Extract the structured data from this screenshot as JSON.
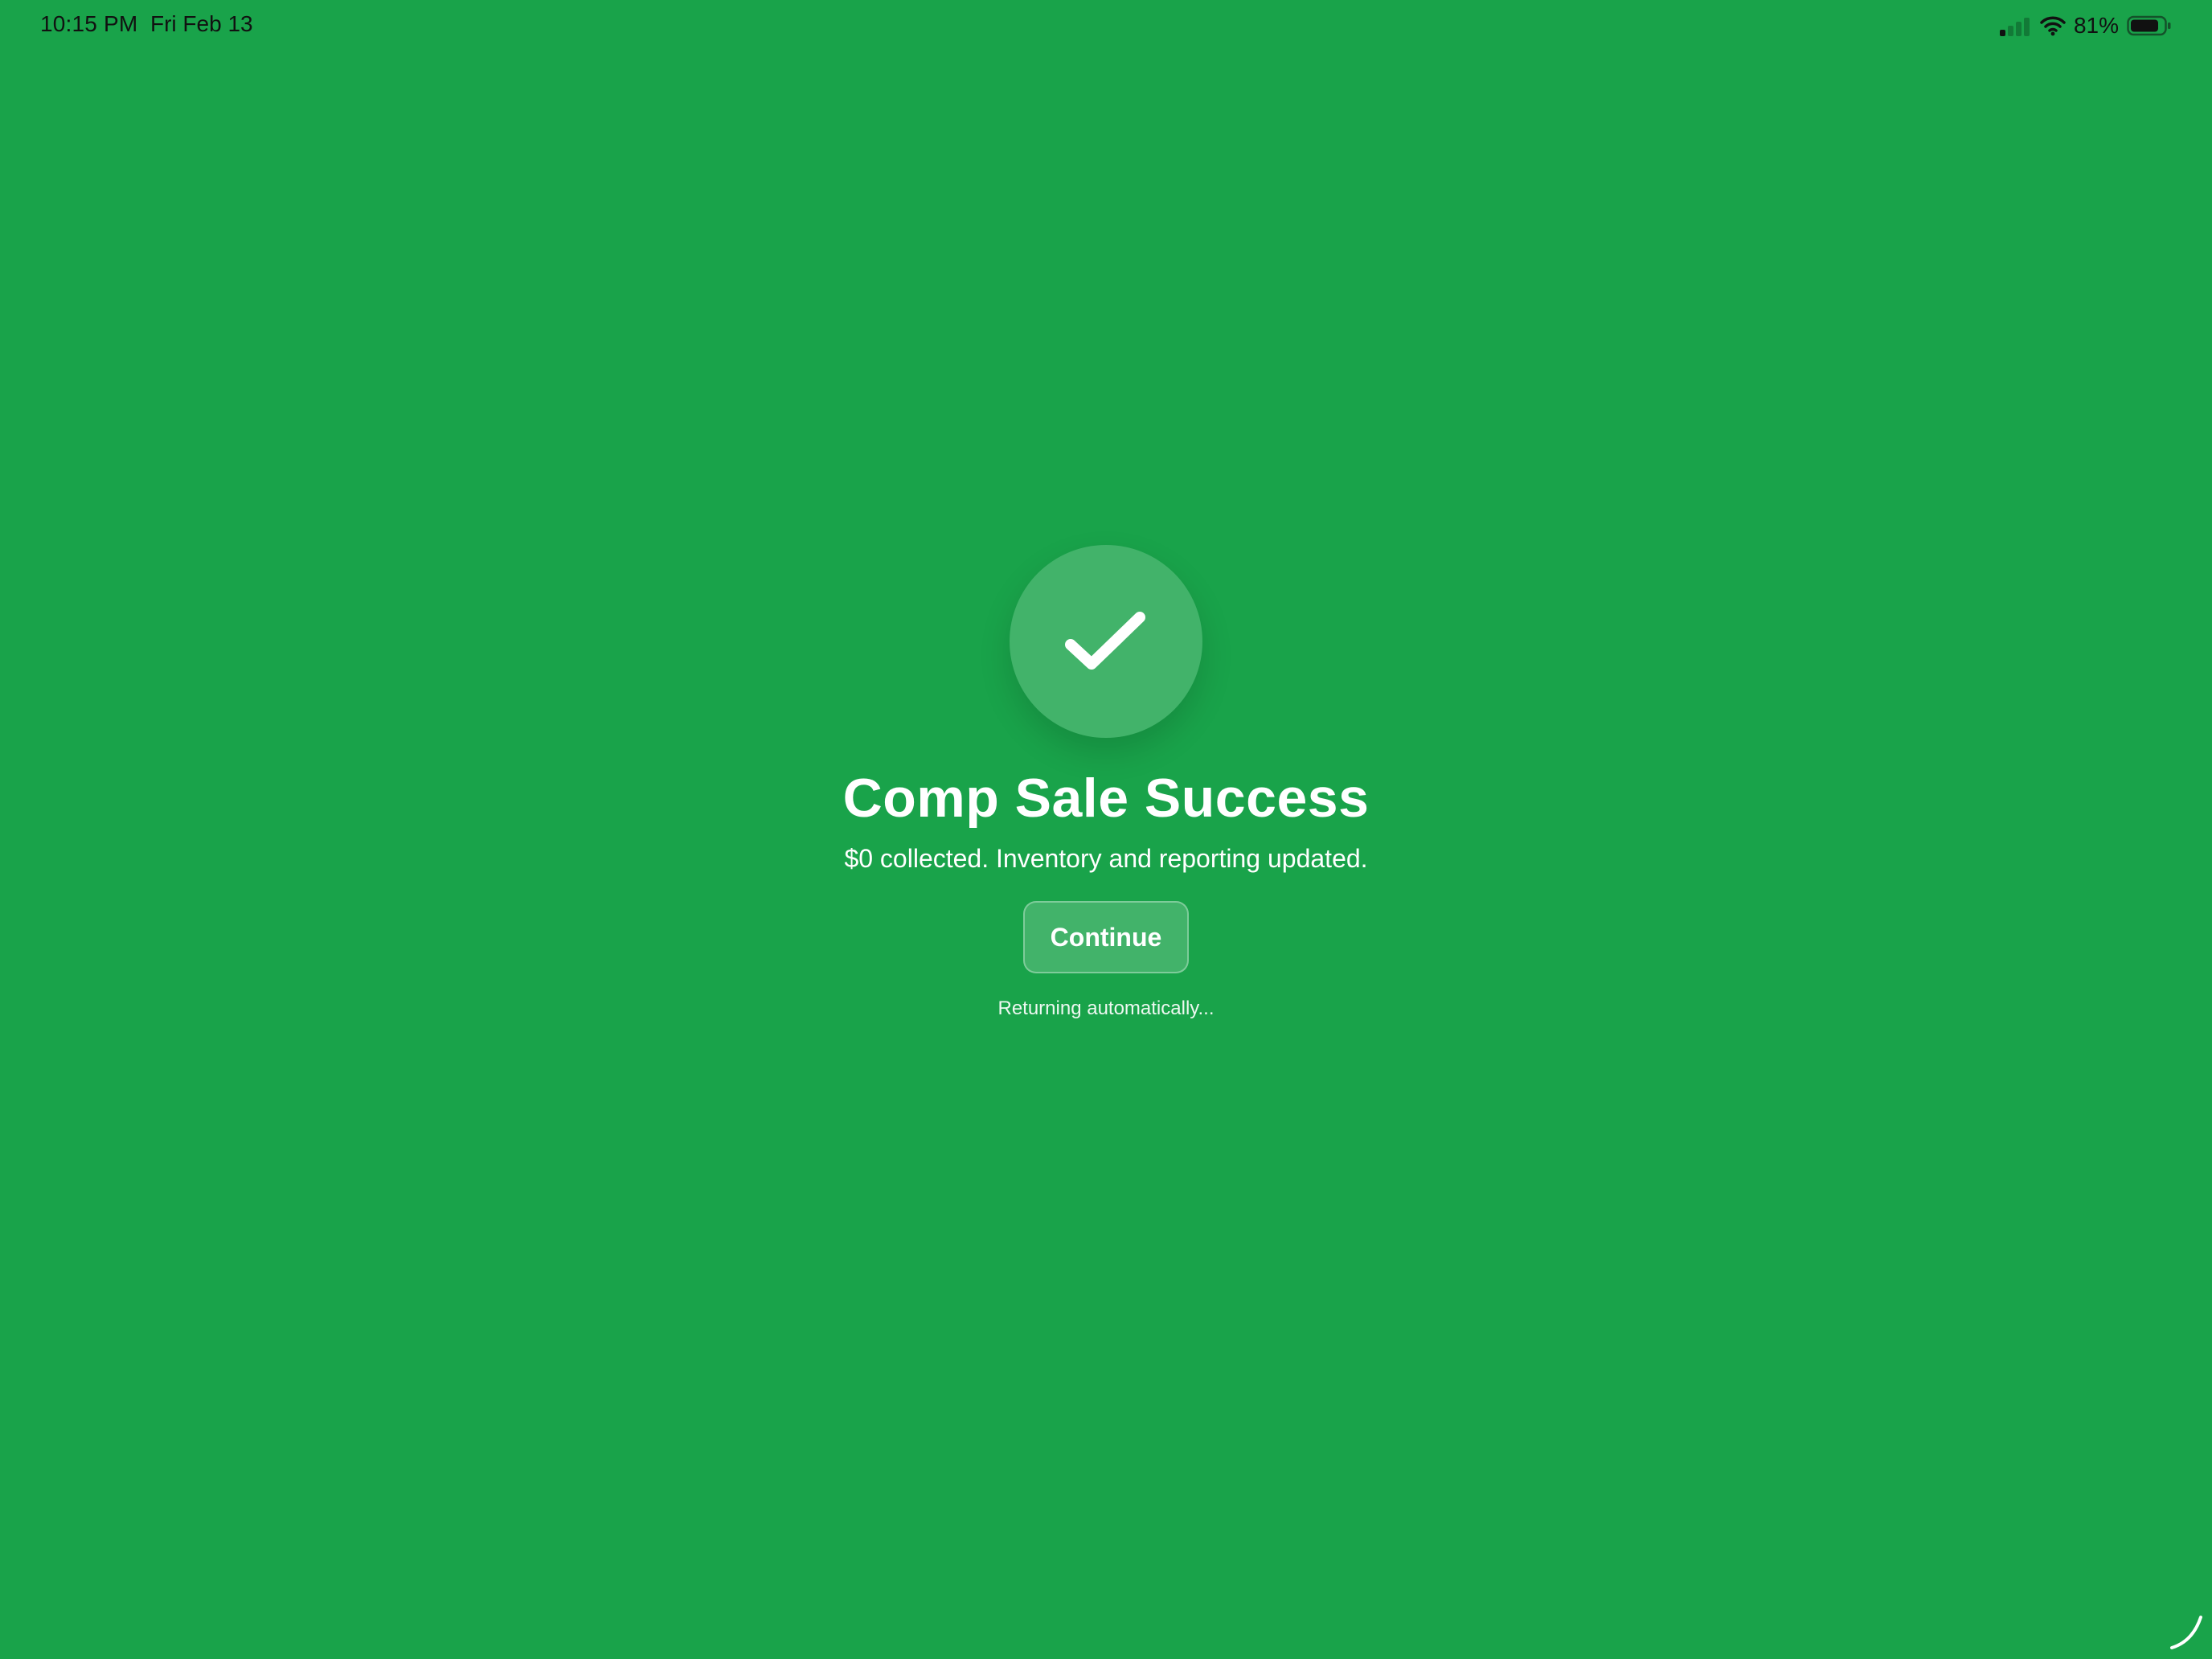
{
  "status_bar": {
    "time": "10:15 PM",
    "date": "Fri Feb 13",
    "battery_percent": "81%",
    "signal_bars_active": 1,
    "signal_bars_total": 4,
    "battery_level": 0.81,
    "icons": [
      "signal-icon",
      "wifi-icon",
      "battery-icon"
    ]
  },
  "success": {
    "icon": "checkmark-icon",
    "title": "Comp Sale Success",
    "subtitle": "$0 collected. Inventory and reporting updated.",
    "continue_label": "Continue",
    "returning_text": "Returning automatically..."
  },
  "colors": {
    "background": "#19a34a",
    "text": "#ffffff",
    "status_text": "#111111"
  }
}
